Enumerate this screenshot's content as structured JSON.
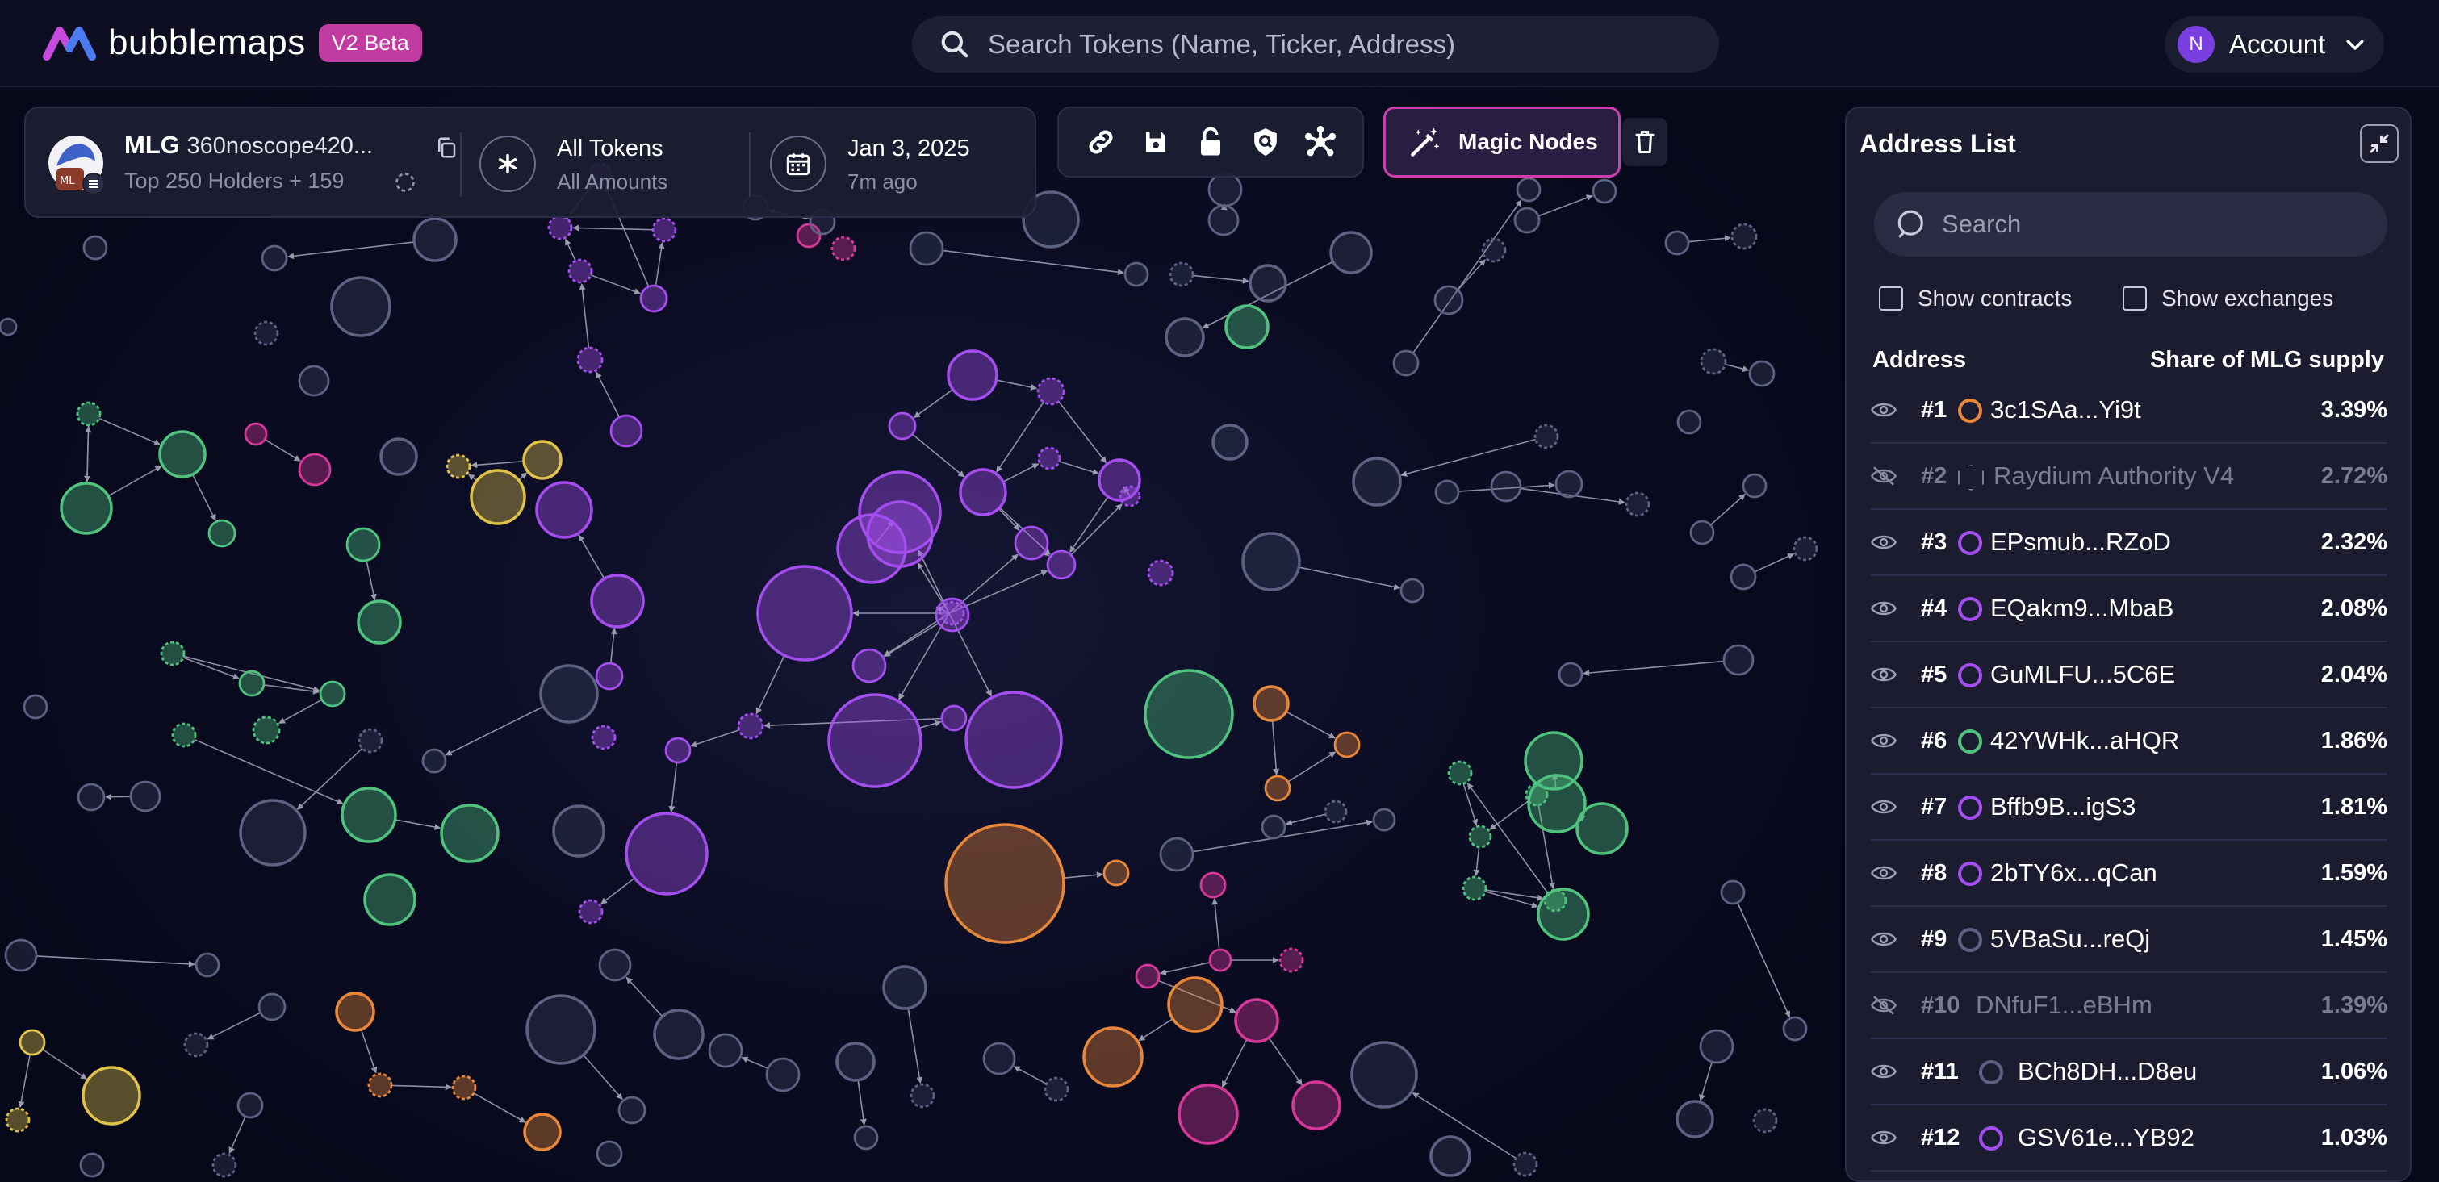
{
  "header": {
    "brand": "bubblemaps",
    "badge": "V2 Beta",
    "search_placeholder": "Search Tokens (Name, Ticker, Address)",
    "account_initial": "N",
    "account_label": "Account"
  },
  "token": {
    "ticker": "MLG",
    "name": "360noscope420...",
    "holders": "Top 250 Holders + 159",
    "token_filter": "All Tokens",
    "amount_filter": "All Amounts",
    "date": "Jan 3, 2025",
    "date_relative": "7m ago",
    "logo_text": "ML"
  },
  "toolbar": {
    "icons": [
      "link-icon",
      "save-icon",
      "unlock-icon",
      "shield-search-icon",
      "network-icon"
    ],
    "magic_nodes_label": "Magic Nodes"
  },
  "address_list": {
    "title": "Address List",
    "search_placeholder": "Search",
    "show_contracts": "Show contracts",
    "show_exchanges": "Show exchanges",
    "col_address": "Address",
    "col_share": "Share of MLG supply",
    "rows": [
      {
        "rank": "#1",
        "address": "3c1SAa...Yi9t",
        "share": "3.39%",
        "color": "#e8873a",
        "hidden": false
      },
      {
        "rank": "#2",
        "address": "Raydium Authority V4",
        "share": "2.72%",
        "color": "#7a7c94",
        "hidden": true,
        "contract": true
      },
      {
        "rank": "#3",
        "address": "EPsmub...RZoD",
        "share": "2.32%",
        "color": "#a54ef0",
        "hidden": false
      },
      {
        "rank": "#4",
        "address": "EQakm9...MbaB",
        "share": "2.08%",
        "color": "#a54ef0",
        "hidden": false
      },
      {
        "rank": "#5",
        "address": "GuMLFU...5C6E",
        "share": "2.04%",
        "color": "#a54ef0",
        "hidden": false
      },
      {
        "rank": "#6",
        "address": "42YWHk...aHQR",
        "share": "1.86%",
        "color": "#4fc27e",
        "hidden": false
      },
      {
        "rank": "#7",
        "address": "Bffb9B...igS3",
        "share": "1.81%",
        "color": "#a54ef0",
        "hidden": false
      },
      {
        "rank": "#8",
        "address": "2bTY6x...qCan",
        "share": "1.59%",
        "color": "#a54ef0",
        "hidden": false
      },
      {
        "rank": "#9",
        "address": "5VBaSu...reQj",
        "share": "1.45%",
        "color": "#5d6282",
        "hidden": false
      },
      {
        "rank": "#10",
        "address": "DNfuF1...eBHm",
        "share": "1.39%",
        "color": "#5d6282",
        "hidden": true
      },
      {
        "rank": "#11",
        "address": "BCh8DH...D8eu",
        "share": "1.06%",
        "color": "#5d6282",
        "hidden": false
      },
      {
        "rank": "#12",
        "address": "GSV61e...YB92",
        "share": "1.03%",
        "color": "#a54ef0",
        "hidden": false
      }
    ]
  },
  "colors": {
    "purple": "#a54ef0",
    "green": "#4fc27e",
    "orange": "#e8873a",
    "yellow": "#e0c24a",
    "pink": "#d6389a",
    "grey": "#5d6282",
    "accent": "#c93fb0"
  }
}
